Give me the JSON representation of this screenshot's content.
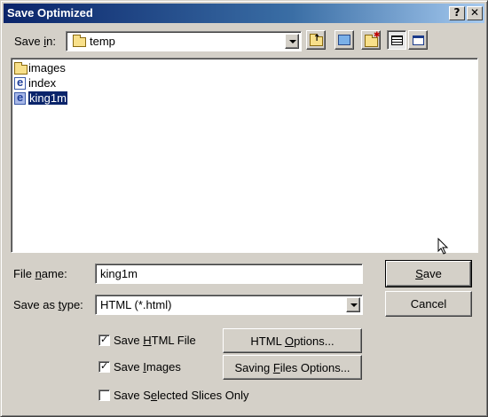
{
  "window": {
    "title": "Save Optimized",
    "help_button": "?",
    "close_button": "✕"
  },
  "save_in": {
    "label_prefix": "Save ",
    "label_mnemonic": "i",
    "label_suffix": "n:",
    "value": "temp"
  },
  "toolbar_icons": [
    "up-folder-icon",
    "desktop-icon",
    "new-folder-icon",
    "list-view-icon",
    "details-view-icon"
  ],
  "files": [
    {
      "name": "images",
      "icon": "folder-icon",
      "selected": false
    },
    {
      "name": "index",
      "icon": "html-file-icon",
      "selected": false
    },
    {
      "name": "king1m",
      "icon": "html-file-icon",
      "selected": true
    }
  ],
  "file_name": {
    "label_prefix": "File ",
    "label_mnemonic": "n",
    "label_suffix": "ame:",
    "value": "king1m"
  },
  "save_as_type": {
    "label_prefix": "Save as ",
    "label_mnemonic": "t",
    "label_suffix": "ype:",
    "value": "HTML (*.html)"
  },
  "buttons": {
    "save_mnemonic": "S",
    "save_rest": "ave",
    "cancel": "Cancel",
    "html_options_prefix": "HTML ",
    "html_options_mnemonic": "O",
    "html_options_suffix": "ptions...",
    "saving_files_prefix": "Saving ",
    "saving_files_mnemonic": "F",
    "saving_files_suffix": "iles Options..."
  },
  "checkboxes": {
    "save_html": {
      "prefix": "Save ",
      "mnemonic": "H",
      "suffix": "TML File",
      "checked": true,
      "mark": "✓"
    },
    "save_images": {
      "prefix": "Save ",
      "mnemonic": "I",
      "suffix": "mages",
      "checked": true,
      "mark": "✓"
    },
    "save_selected": {
      "prefix": "Save S",
      "mnemonic": "e",
      "suffix": "lected Slices Only",
      "checked": false,
      "mark": ""
    }
  }
}
